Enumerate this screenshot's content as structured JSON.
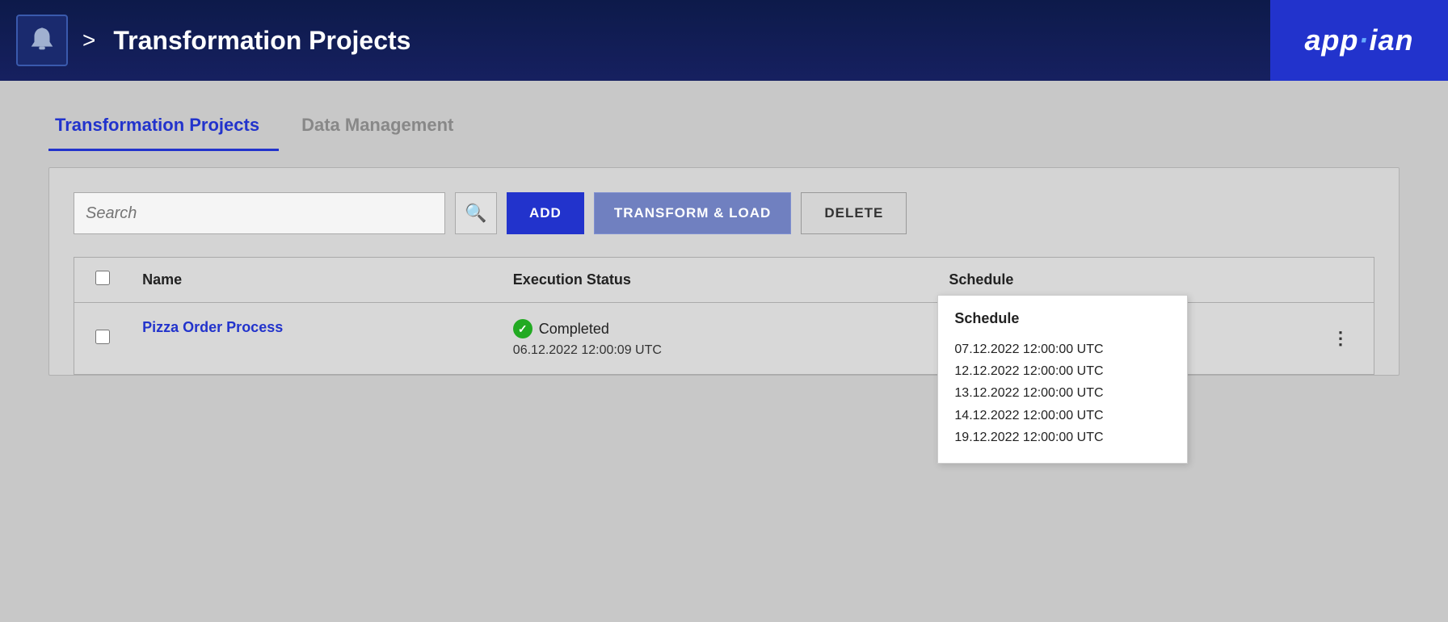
{
  "topnav": {
    "title": "Transformation Projects",
    "chevron": ">",
    "grid_label": "apps-grid",
    "user_label": "user-menu",
    "dropdown_label": "▾",
    "brand": "app·ian"
  },
  "tabs": [
    {
      "id": "transformation-projects",
      "label": "Transformation Projects",
      "active": true
    },
    {
      "id": "data-management",
      "label": "Data Management",
      "active": false
    }
  ],
  "toolbar": {
    "search_placeholder": "Search",
    "add_label": "ADD",
    "transform_label": "TRANSFORM & LOAD",
    "delete_label": "DELETE"
  },
  "table": {
    "columns": [
      {
        "id": "checkbox",
        "label": ""
      },
      {
        "id": "name",
        "label": "Name"
      },
      {
        "id": "execution_status",
        "label": "Execution Status"
      },
      {
        "id": "schedule",
        "label": "Schedule"
      },
      {
        "id": "actions",
        "label": ""
      }
    ],
    "rows": [
      {
        "id": 1,
        "name": "Pizza Order Process",
        "status": "Completed",
        "status_datetime": "06.12.2022 12:00:09 UTC",
        "schedule": [
          "07.12.2022 12:00:00 UTC",
          "12.12.2022 12:00:00 UTC",
          "13.12.2022 12:00:00 UTC",
          "14.12.2022 12:00:00 UTC",
          "19.12.2022 12:00:00 UTC"
        ]
      }
    ]
  },
  "colors": {
    "nav_bg": "#0d1a4a",
    "brand_bg": "#2233cc",
    "active_tab": "#2233cc",
    "add_btn": "#2233cc",
    "transform_btn": "#7080c0",
    "link_color": "#2233cc",
    "completed_green": "#22aa22"
  }
}
